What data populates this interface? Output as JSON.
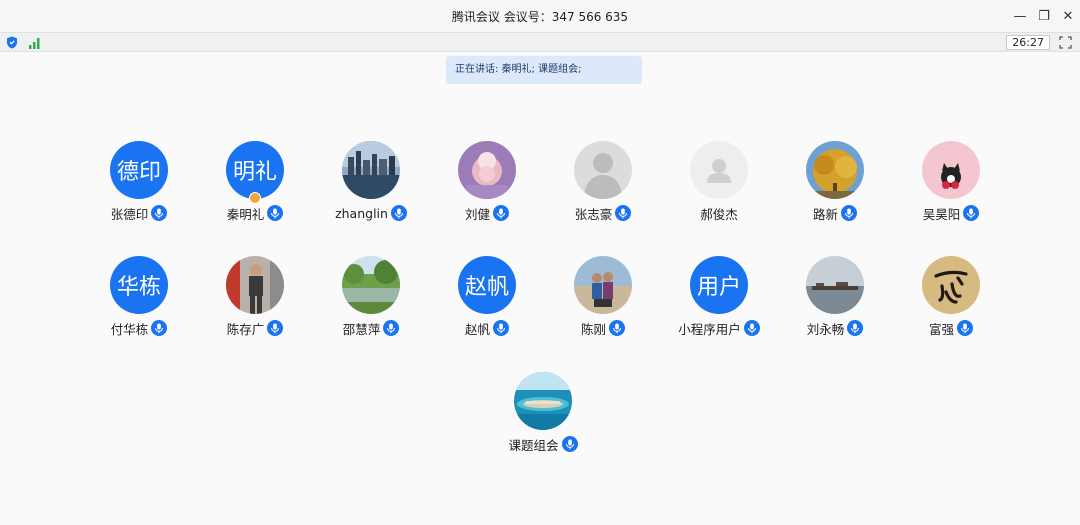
{
  "window": {
    "title": "腾讯会议 会议号：347 566 635",
    "minimize_icon": "minimize-icon",
    "restore_icon": "restore-icon",
    "close_icon": "close-icon"
  },
  "toolbar": {
    "timer": "26:27"
  },
  "speaking": {
    "text": "正在讲话: 秦明礼; 课题组会;"
  },
  "participants": [
    {
      "name": "张德印",
      "avatar_text": "德印",
      "mic": true
    },
    {
      "name": "秦明礼",
      "avatar_text": "明礼",
      "mic": true,
      "host": true
    },
    {
      "name": "zhanglin",
      "avatar_photo": "city-skyline-photo",
      "mic": true
    },
    {
      "name": "刘健",
      "avatar_photo": "baby-photo",
      "mic": true
    },
    {
      "name": "张志豪",
      "avatar_photo": "default-person-gray",
      "mic": true
    },
    {
      "name": "郝俊杰",
      "avatar_photo": "default-person-light",
      "mic": false
    },
    {
      "name": "路新",
      "avatar_photo": "autumn-tree-photo",
      "mic": true
    },
    {
      "name": "吴昊阳",
      "avatar_photo": "cat-cherry-photo",
      "mic": true
    },
    {
      "name": "付华栋",
      "avatar_text": "华栋",
      "mic": true
    },
    {
      "name": "陈存广",
      "avatar_photo": "person-photo",
      "mic": true
    },
    {
      "name": "邵慧萍",
      "avatar_photo": "park-lake-photo",
      "mic": true
    },
    {
      "name": "赵帆",
      "avatar_text": "赵帆",
      "mic": true
    },
    {
      "name": "陈刚",
      "avatar_photo": "couple-beach-photo",
      "mic": true
    },
    {
      "name": "小程序用户",
      "avatar_text": "用户",
      "mic": true
    },
    {
      "name": "刘永畅",
      "avatar_photo": "river-boats-photo",
      "mic": true
    },
    {
      "name": "富强",
      "avatar_photo": "calligraphy-photo",
      "mic": true
    },
    {
      "name": "课题组会",
      "avatar_photo": "island-aerial-photo",
      "mic": true
    }
  ],
  "colors": {
    "accent": "#1a73f0",
    "speaking_bg": "#dde9fb",
    "host_badge": "#f2a53a"
  }
}
